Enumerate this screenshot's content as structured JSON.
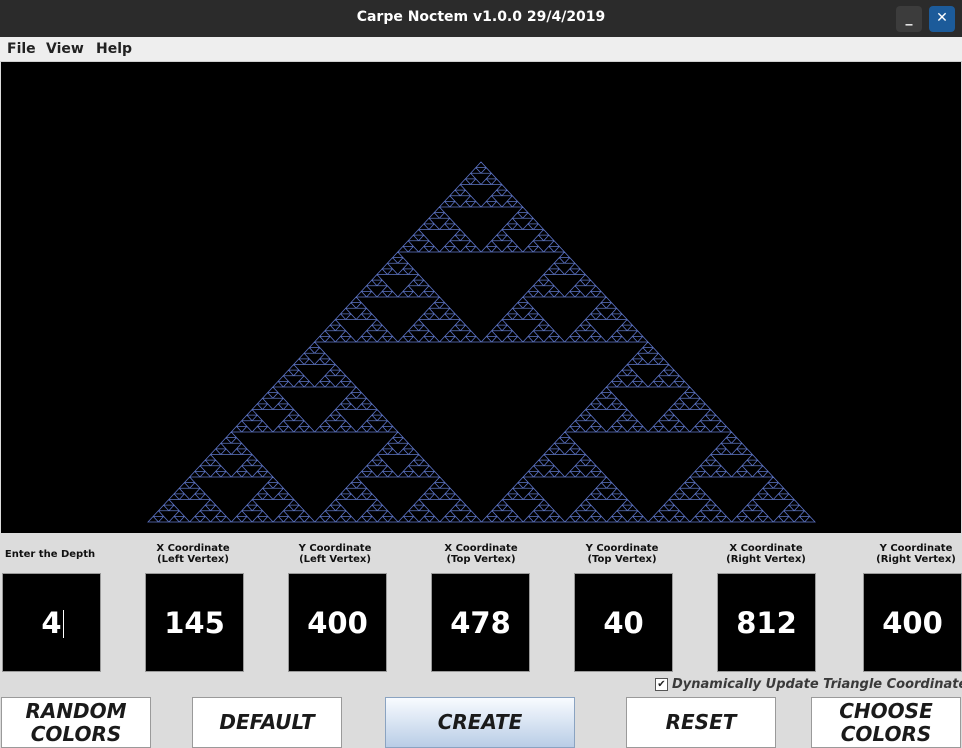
{
  "window": {
    "title": "Carpe Noctem v1.0.0 29/4/2019",
    "minimize_glyph": "_",
    "close_glyph": "✕"
  },
  "menu": {
    "items": [
      "File",
      "View",
      "Help"
    ]
  },
  "canvas": {
    "background_color": "#000000",
    "stroke_color": "#5a6fd8",
    "accent_color": "#6b8f2a"
  },
  "inputs": {
    "depth": {
      "label": "Enter the Depth",
      "value": "4"
    },
    "x_left": {
      "label_line1": "X Coordinate",
      "label_line2": "(Left Vertex)",
      "value": "145"
    },
    "y_left": {
      "label_line1": "Y Coordinate",
      "label_line2": "(Left Vertex)",
      "value": "400"
    },
    "x_top": {
      "label_line1": "X Coordinate",
      "label_line2": "(Top Vertex)",
      "value": "478"
    },
    "y_top": {
      "label_line1": "Y Coordinate",
      "label_line2": "(Top Vertex)",
      "value": "40"
    },
    "x_right": {
      "label_line1": "X Coordinate",
      "label_line2": "(Right Vertex)",
      "value": "812"
    },
    "y_right": {
      "label_line1": "Y Coordinate",
      "label_line2": "(Right Vertex)",
      "value": "400"
    }
  },
  "options": {
    "dynamic_update": {
      "label": "Dynamically Update Triangle Coordinates",
      "checked": true,
      "check_glyph": "✔"
    }
  },
  "buttons": {
    "random_colors": "RANDOM\nCOLORS",
    "default": "DEFAULT",
    "create": "CREATE",
    "reset": "RESET",
    "choose_colors": "CHOOSE\nCOLORS"
  }
}
